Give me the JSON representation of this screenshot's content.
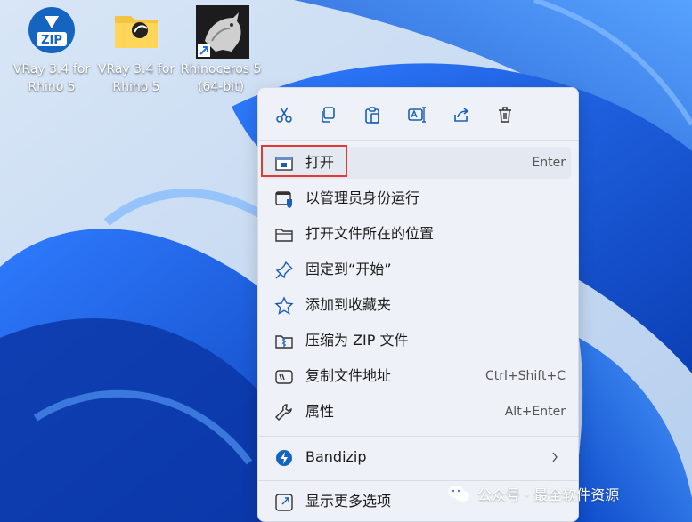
{
  "desktop_icons": [
    {
      "label": "VRay 3.4 for Rhino 5",
      "icon": "zip-app-icon"
    },
    {
      "label": "VRay 3.4 for Rhino 5",
      "icon": "folder-icon"
    },
    {
      "label": "Rhinoceros 5 (64-bit)",
      "icon": "rhino-icon"
    }
  ],
  "toolbar": {
    "cut": "scissors-icon",
    "copy": "copy-icon",
    "paste": "paste-icon",
    "rename": "rename-icon",
    "share": "share-icon",
    "delete": "trash-icon"
  },
  "menu": {
    "items": [
      {
        "label": "打开",
        "shortcut": "Enter",
        "icon": "window-icon"
      },
      {
        "label": "以管理员身份运行",
        "shortcut": "",
        "icon": "shield-icon"
      },
      {
        "label": "打开文件所在的位置",
        "shortcut": "",
        "icon": "folder-icon"
      },
      {
        "label": "固定到“开始”",
        "shortcut": "",
        "icon": "pin-icon"
      },
      {
        "label": "添加到收藏夹",
        "shortcut": "",
        "icon": "star-icon"
      },
      {
        "label": "压缩为 ZIP 文件",
        "shortcut": "",
        "icon": "zip-icon"
      },
      {
        "label": "复制文件地址",
        "shortcut": "Ctrl+Shift+C",
        "icon": "path-icon"
      },
      {
        "label": "属性",
        "shortcut": "Alt+Enter",
        "icon": "wrench-icon"
      }
    ],
    "bandizip": {
      "label": "Bandizip",
      "icon": "bandizip-icon",
      "arrow": "chevron-right-icon"
    },
    "more": {
      "label": "显示更多选项",
      "icon": "more-options-icon"
    }
  },
  "watermark": {
    "text": "公众号 · 最全软件资源"
  },
  "colors": {
    "accent": "#1a73e8",
    "highlight_border": "#e53935",
    "wallpaper": "#1557d6"
  }
}
